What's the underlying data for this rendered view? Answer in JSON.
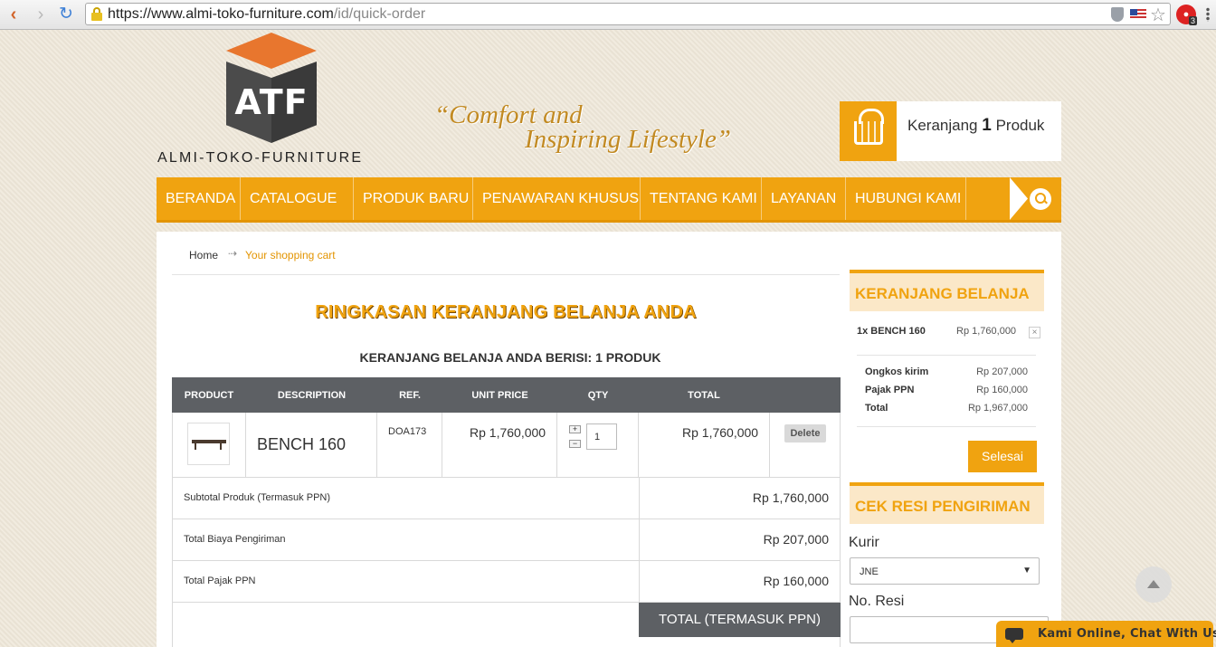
{
  "browser": {
    "url_host": "https://www.almi-toko-furniture.com",
    "url_path": "/id/quick-order",
    "extension_badge": "3"
  },
  "header": {
    "logo_letters": "ATF",
    "logo_text": "ALMI-TOKO-FURNITURE",
    "tagline_line1": "“Comfort and",
    "tagline_line2": "Inspiring Lifestyle”",
    "cart_label": "Keranjang",
    "cart_count": "1",
    "cart_unit": "Produk"
  },
  "nav": {
    "items": [
      "BERANDA",
      "CATALOGUE",
      "PRODUK BARU",
      "PENAWARAN KHUSUS",
      "TENTANG KAMI",
      "LAYANAN",
      "HUBUNGI KAMI"
    ]
  },
  "breadcrumb": {
    "home": "Home",
    "separator": "⇢",
    "current": "Your shopping cart"
  },
  "main": {
    "title": "RINGKASAN KERANJANG BELANJA ANDA",
    "subtitle": "KERANJANG BELANJA ANDA BERISI: 1 PRODUK",
    "columns": [
      "PRODUCT",
      "DESCRIPTION",
      "REF.",
      "UNIT PRICE",
      "QTY",
      "TOTAL"
    ],
    "item": {
      "name": "BENCH 160",
      "ref": "DOA173",
      "unit_price": "Rp 1,760,000",
      "qty": "1",
      "total": "Rp 1,760,000",
      "delete_label": "Delete"
    },
    "summary": [
      {
        "label": "Subtotal Produk (Termasuk PPN)",
        "value": "Rp 1,760,000"
      },
      {
        "label": "Total Biaya Pengiriman",
        "value": "Rp 207,000"
      },
      {
        "label": "Total Pajak PPN",
        "value": "Rp 160,000"
      }
    ],
    "grand_total_label": "TOTAL (TERMASUK PPN)"
  },
  "sidebar": {
    "cart_title": "KERANJANG BELANJA",
    "item_label": "1x BENCH 160",
    "item_price": "Rp 1,760,000",
    "remove_symbol": "×",
    "totals": [
      {
        "label": "Ongkos kirim",
        "value": "Rp 207,000"
      },
      {
        "label": "Pajak PPN",
        "value": "Rp 160,000"
      },
      {
        "label": "Total",
        "value": "Rp 1,967,000"
      }
    ],
    "checkout_label": "Selesai",
    "resi_title": "CEK RESI PENGIRIMAN",
    "kurir_label": "Kurir",
    "kurir_value": "JNE",
    "resi_label": "No. Resi"
  },
  "chat": {
    "label": "Kami Online, Chat With Us"
  },
  "colors": {
    "accent": "#f0a310",
    "header_dark": "#5d6064"
  }
}
